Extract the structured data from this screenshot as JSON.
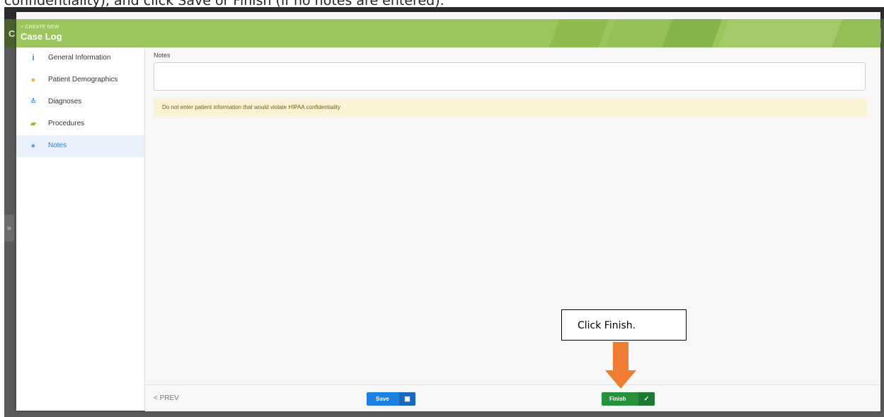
{
  "doc_caption": "confidentiality), and click Save or Finish (if no notes are entered).",
  "background": {
    "left_letter": "C",
    "side_toggle_icon": "»"
  },
  "modal": {
    "close_icon": "×",
    "header": {
      "subtitle": "+ CREATE NEW",
      "title": "Case Log",
      "color": "#9cc55e"
    },
    "sidebar": {
      "items": [
        {
          "label": "General Information",
          "icon": "info-icon",
          "glyph": "i",
          "color": "#2a7dd6"
        },
        {
          "label": "Patient Demographics",
          "icon": "user-icon",
          "glyph": "●",
          "color": "#f0b429"
        },
        {
          "label": "Diagnoses",
          "icon": "diagnoses-icon",
          "glyph": "≛",
          "color": "#2a7dd6"
        },
        {
          "label": "Procedures",
          "icon": "procedures-icon",
          "glyph": "▰",
          "color": "#8cbf3f"
        },
        {
          "label": "Notes",
          "icon": "notes-icon",
          "glyph": "●",
          "color": "#6aa0d8",
          "active": true
        }
      ]
    },
    "content": {
      "notes_label": "Notes",
      "notes_value": "",
      "warning": "Do not enter patient information that would violate HIPAA confidentiality"
    },
    "footer": {
      "prev_label": "< PREV",
      "save_label": "Save",
      "save_icon": "▣",
      "finish_label": "Finish",
      "finish_icon": "✓"
    }
  },
  "annotation": {
    "callout_text": "Click Finish.",
    "arrow_color": "#ee7d31"
  }
}
